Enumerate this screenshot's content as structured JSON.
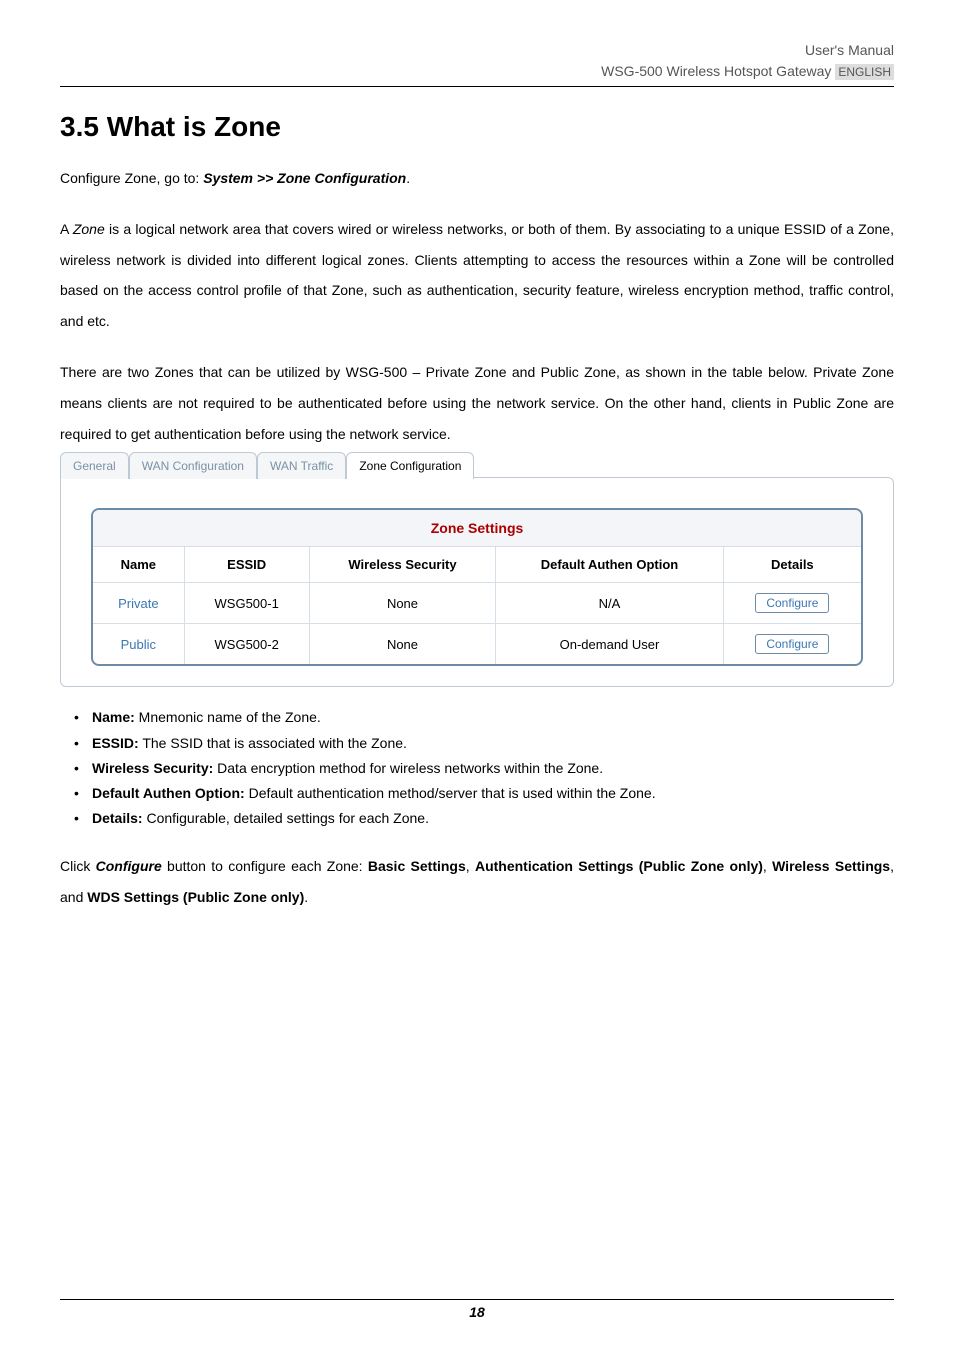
{
  "header": {
    "line1": "User's Manual",
    "product": "WSG-500 Wireless Hotspot Gateway",
    "lang": "ENGLISH"
  },
  "title": "3.5  What is Zone",
  "intro_prefix": "Configure Zone, go to: ",
  "intro_path": "System >> Zone Configuration",
  "intro_suffix": ".",
  "para1_a": "A ",
  "para1_zone": "Zone",
  "para1_b": " is a logical network area that covers wired or wireless networks, or both of them. By associating to a unique ESSID of a Zone, wireless network is divided into different logical zones. Clients attempting to access the resources within a Zone will be controlled based on the access control profile of that Zone, such as authentication, security feature, wireless encryption method, traffic control, and etc.",
  "para2": "There are two Zones that can be utilized by WSG-500 – Private Zone and Public Zone, as shown in the table below. Private Zone means clients are not required to be authenticated before using the network service. On the other hand, clients in Public Zone are required to get authentication before using the network service.",
  "tabs": {
    "t0": "General",
    "t1": "WAN Configuration",
    "t2": "WAN Traffic",
    "t3": "Zone Configuration"
  },
  "table": {
    "title": "Zone Settings",
    "headers": {
      "name": "Name",
      "essid": "ESSID",
      "ws": "Wireless Security",
      "dao": "Default Authen Option",
      "details": "Details"
    },
    "rows": [
      {
        "name": "Private",
        "essid": "WSG500-1",
        "ws": "None",
        "dao": "N/A",
        "btn": "Configure"
      },
      {
        "name": "Public",
        "essid": "WSG500-2",
        "ws": "None",
        "dao": "On-demand User",
        "btn": "Configure"
      }
    ]
  },
  "bullets": {
    "b0_t": "Name:",
    "b0_d": " Mnemonic name of the Zone.",
    "b1_t": "ESSID:",
    "b1_d": " The SSID that is associated with the Zone.",
    "b2_t": "Wireless Security:",
    "b2_d": " Data encryption method for wireless networks within the Zone.",
    "b3_t": "Default Authen Option:",
    "b3_d": " Default authentication method/server that is used within the Zone.",
    "b4_t": "Details:",
    "b4_d": " Configurable, detailed settings for each Zone."
  },
  "closing": {
    "a": "Click ",
    "configure": "Configure",
    "b": " button to configure each Zone: ",
    "s1": "Basic Settings",
    "c": ", ",
    "s2": "Authentication Settings (Public Zone only)",
    "d": ", ",
    "s3": "Wireless Settings",
    "e": ", and ",
    "s4": "WDS Settings (Public Zone only)",
    "f": "."
  },
  "page_number": "18"
}
